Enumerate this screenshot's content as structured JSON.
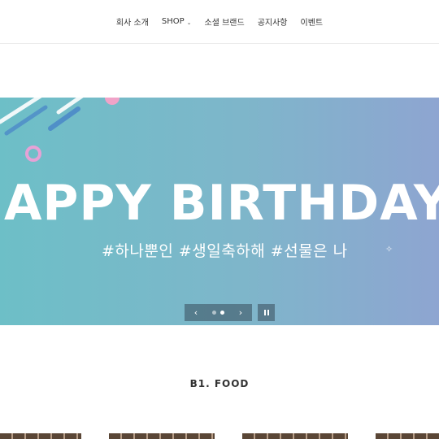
{
  "nav": {
    "items": [
      {
        "label": "회사 소개",
        "has_dropdown": false
      },
      {
        "label": "SHOP",
        "has_dropdown": true
      },
      {
        "label": "소셜 브랜드",
        "has_dropdown": false
      },
      {
        "label": "공지사항",
        "has_dropdown": false
      },
      {
        "label": "이벤트",
        "has_dropdown": false
      }
    ],
    "dropdown_icon": "chevron-down-icon"
  },
  "hero": {
    "headline": "APPY BIRTHDAY",
    "tagline": "#하나뿐인 #생일축하해 #선물은 나",
    "colors": {
      "gradient_start": "#6dbfc7",
      "gradient_end": "#8ea5d1",
      "accent_pink": "#f0a3c8",
      "accent_blue": "#4a87c9"
    },
    "slider": {
      "prev_icon": "chevron-left-icon",
      "next_icon": "chevron-right-icon",
      "pause_icon": "pause-icon",
      "slide_count": 2,
      "active_slide": 2
    }
  },
  "section": {
    "title": "B1. FOOD"
  }
}
